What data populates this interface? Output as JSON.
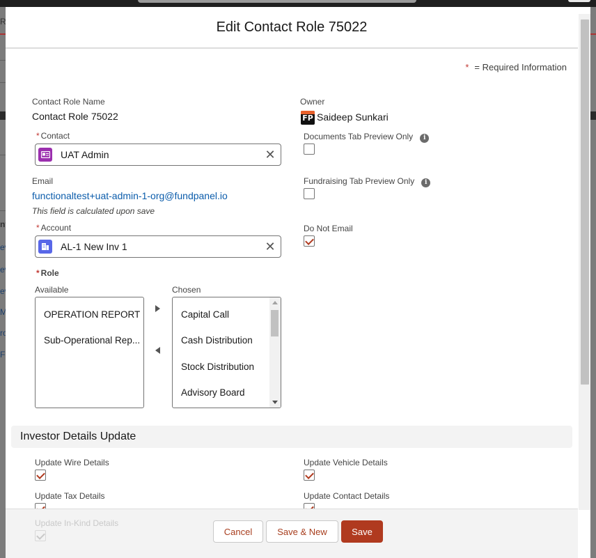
{
  "background": {
    "fragments": [
      "Re",
      "nt",
      "ev",
      "ev",
      "ev",
      "Ma",
      "ro",
      "F"
    ]
  },
  "modal": {
    "title": "Edit Contact Role 75022",
    "required_note": "= Required Information",
    "required_star": "*"
  },
  "form": {
    "contact_role_name_label": "Contact Role Name",
    "contact_role_name_value": "Contact Role 75022",
    "owner_label": "Owner",
    "owner_logo_text": "FP",
    "owner_value": "Saideep Sunkari",
    "contact_label": "Contact",
    "contact_value": "UAT Admin",
    "documents_tab_label": "Documents Tab Preview Only",
    "documents_tab_checked": false,
    "email_label": "Email",
    "email_value": "functionaltest+uat-admin-1-org@fundpanel.io",
    "email_note": "This field is calculated upon save",
    "fundraising_tab_label": "Fundraising Tab Preview Only",
    "fundraising_tab_checked": false,
    "account_label": "Account",
    "account_value": "AL-1 New Inv 1",
    "do_not_email_label": "Do Not Email",
    "do_not_email_checked": true,
    "role_label": "Role",
    "available_label": "Available",
    "available_options": [
      "OPERATION REPORT",
      "Sub-Operational Rep..."
    ],
    "chosen_label": "Chosen",
    "chosen_options": [
      "Capital Call",
      "Cash Distribution",
      "Stock Distribution",
      "Advisory Board"
    ]
  },
  "investor_details": {
    "section_title": "Investor Details Update",
    "update_wire_label": "Update Wire Details",
    "update_wire_checked": true,
    "update_vehicle_label": "Update Vehicle Details",
    "update_vehicle_checked": true,
    "update_tax_label": "Update Tax Details",
    "update_tax_checked": true,
    "update_contact_label": "Update Contact Details",
    "update_contact_checked": true,
    "update_inkind_label": "Update In-Kind Details",
    "update_inkind_checked": true
  },
  "footer": {
    "cancel_label": "Cancel",
    "save_new_label": "Save & New",
    "save_label": "Save"
  },
  "colors": {
    "brand": "#b03a1f",
    "link": "#0b5cab",
    "required": "#c23934",
    "contact_icon": "#9b2fae",
    "account_icon": "#5867e8"
  }
}
